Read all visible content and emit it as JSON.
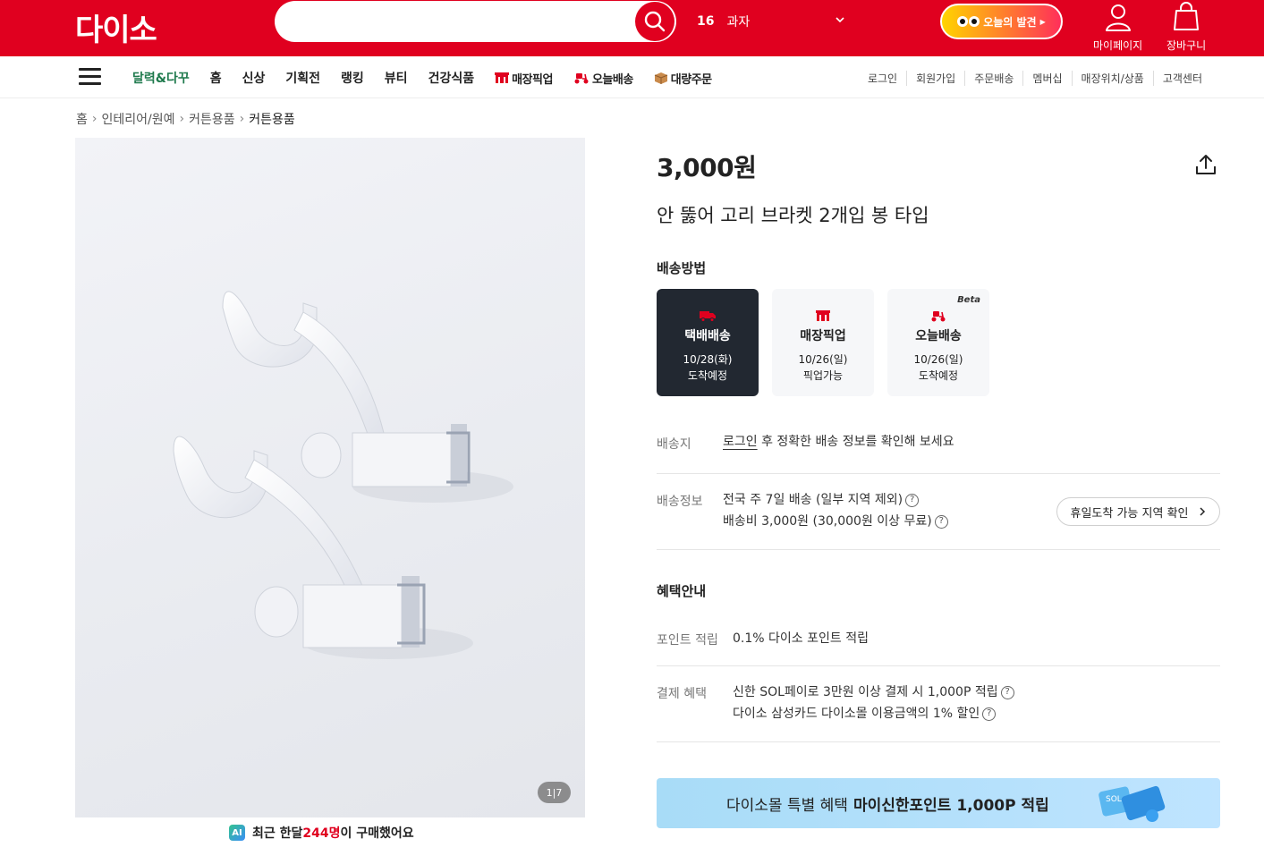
{
  "header": {
    "logo": "다이소",
    "search_placeholder": "",
    "rank_num": "16",
    "rank_keyword": "과자",
    "discover_label": "오늘의 발견",
    "mypage_label": "마이페이지",
    "cart_label": "장바구니",
    "brand_color": "#e0001f"
  },
  "nav": {
    "items": [
      {
        "label": "달력&다꾸"
      },
      {
        "label": "홈"
      },
      {
        "label": "신상"
      },
      {
        "label": "기획전"
      },
      {
        "label": "랭킹"
      },
      {
        "label": "뷰티"
      },
      {
        "label": "건강식품"
      },
      {
        "label": "매장픽업"
      },
      {
        "label": "오늘배송"
      },
      {
        "label": "대량주문"
      }
    ],
    "util": [
      "로그인",
      "회원가입",
      "주문배송",
      "멤버십",
      "매장위치/상품",
      "고객센터"
    ]
  },
  "breadcrumb": [
    "홈",
    "인테리어/원예",
    "커튼용품",
    "커튼용품"
  ],
  "gallery": {
    "counter": "1|7"
  },
  "buyers": {
    "prefix": "최근 한달 ",
    "count": "244명",
    "suffix": "이 구매했어요",
    "badge": "AI"
  },
  "product": {
    "price": "3,000원",
    "title": "안 뚫어 고리 브라켓 2개입 봉 타입"
  },
  "shipping": {
    "heading": "배송방법",
    "options": [
      {
        "name": "택배배송",
        "date": "10/28(화)",
        "note": "도착예정",
        "active": true
      },
      {
        "name": "매장픽업",
        "date": "10/26(일)",
        "note": "픽업가능",
        "active": false
      },
      {
        "name": "오늘배송",
        "date": "10/26(일)",
        "note": "도착예정",
        "badge": "Beta",
        "active": false
      }
    ],
    "dest_label": "배송지",
    "dest_link": "로그인",
    "dest_text": " 후 정확한 배송 정보를 확인해 보세요",
    "info_label": "배송정보",
    "info_line1": "전국 주 7일 배송 (일부 지역 제외)",
    "info_line2": "배송비 3,000원 (30,000원 이상 무료)",
    "holiday_button": "휴일도착 가능 지역 확인"
  },
  "benefits": {
    "heading": "혜택안내",
    "point_label": "포인트 적립",
    "point_text": "0.1% 다이소 포인트 적립",
    "pay_label": "결제 혜택",
    "pay_line1": "신한 SOL페이로 3만원 이상 결제 시 1,000P 적립",
    "pay_line2": "다이소 삼성카드 다이소몰 이용금액의 1% 할인"
  },
  "banner": {
    "text": "다이소몰 특별 혜택",
    "bold": "마이신한포인트 1,000P 적립",
    "card_text": "SOL"
  }
}
